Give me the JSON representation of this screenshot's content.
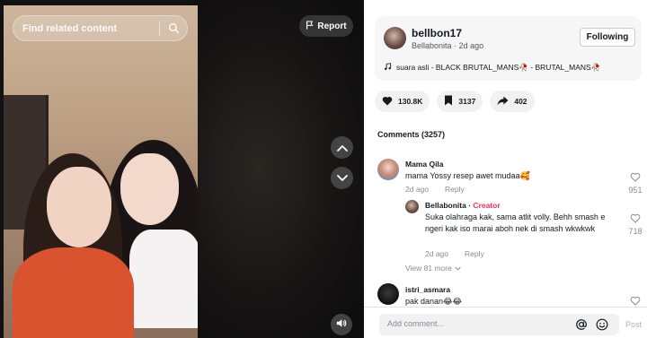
{
  "video": {
    "search_placeholder": "Find related content",
    "report_label": "Report"
  },
  "author": {
    "username": "bellbon17",
    "nickname": "Bellabonita",
    "posted": "2d ago",
    "follow_label": "Following",
    "music": "suara asli - BLACK BRUTAL_MANS🥀 - BRUTAL_MANS🥀"
  },
  "actions": {
    "likes": "130.8K",
    "saves": "3137",
    "shares": "402"
  },
  "comments_header": "Comments (3257)",
  "comments": [
    {
      "name": "Mama Qila",
      "text": "mama Yossy resep awet mudaa🥰",
      "time": "2d ago",
      "reply_label": "Reply",
      "likes": "951"
    },
    {
      "name": "Bellabonita",
      "creator_label": "Creator",
      "text": "Suka olahraga kak, sama atlit volly. Behh smash e ngeri kak iso marai aboh nek di smash wkwkwk",
      "time": "2d ago",
      "reply_label": "Reply",
      "likes": "718"
    },
    {
      "view_more": "View 81 more"
    },
    {
      "name": "istri_asmara",
      "text": "pak danan😂😂",
      "likes": ""
    }
  ],
  "comment_bar": {
    "placeholder": "Add comment...",
    "post_label": "Post"
  },
  "colors": {
    "accent": "#fe2c55",
    "panel_chip": "#f1f1f2",
    "muted_text": "#8a8b91"
  }
}
